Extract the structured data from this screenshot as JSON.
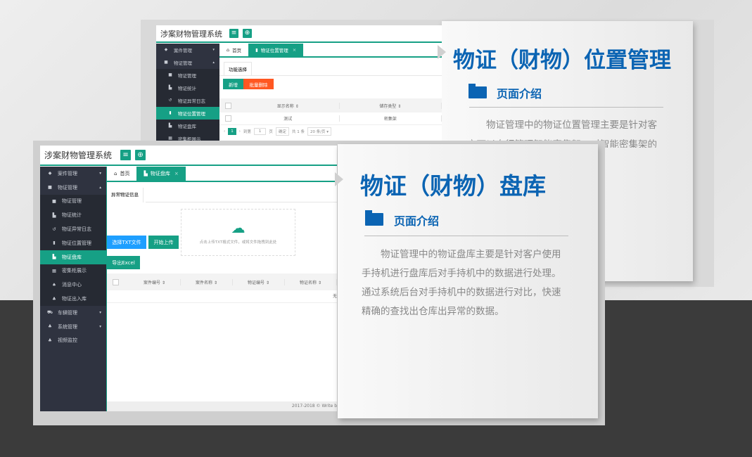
{
  "back_panel": {
    "app_title": "涉案财物管理系统",
    "header_icons": [
      "menu-icon",
      "plus-circle-icon"
    ],
    "sidebar": [
      {
        "label": "案件管理",
        "icon": "tag-icon",
        "caret": "▾"
      },
      {
        "label": "物证管理",
        "icon": "box-icon",
        "caret": "▴"
      },
      {
        "label": "物证管理",
        "icon": "box-icon",
        "sub": true
      },
      {
        "label": "物证统计",
        "icon": "chart-icon",
        "sub": true
      },
      {
        "label": "物证异常日志",
        "icon": "history-icon",
        "sub": true
      },
      {
        "label": "物证位置管理",
        "icon": "bookmark-icon",
        "sub": true,
        "active": true
      },
      {
        "label": "物证盘库",
        "icon": "chart-icon",
        "sub": true
      },
      {
        "label": "密集柜展示",
        "icon": "grid-icon",
        "sub": true
      }
    ],
    "tabs": [
      {
        "label": "首页",
        "icon": "home-icon"
      },
      {
        "label": "物证位置管理",
        "icon": "bookmark-icon",
        "active": true,
        "close": "×"
      }
    ],
    "section_tab": "功能选择",
    "add_button": "新增",
    "batch_delete_button": "批量删除",
    "table": {
      "columns": [
        "显示名称 ⇕",
        "储存类型 ⇕"
      ],
      "rows": [
        [
          "测试",
          "密集架"
        ]
      ]
    },
    "pagination": {
      "prev": "‹",
      "page": "1",
      "next": "›",
      "goto_label": "到第",
      "goto_value": "1",
      "page_unit": "页",
      "confirm": "确定",
      "total": "共 1 条",
      "page_size": "20 条/页"
    },
    "title": "物证（财物）位置管理",
    "intro_heading": "页面介绍",
    "intro_text": "物证管理中的物证位置管理主要是针对客户可以自行管理智能密集架，对智能密集架的存储位"
  },
  "front_panel": {
    "app_title": "涉案财物管理系统",
    "sidebar": [
      {
        "label": "案件管理",
        "icon": "tag-icon",
        "caret": "▾"
      },
      {
        "label": "物证管理",
        "icon": "box-icon",
        "caret": "▴"
      },
      {
        "label": "物证管理",
        "icon": "box-icon",
        "sub": true
      },
      {
        "label": "物证统计",
        "icon": "chart-icon",
        "sub": true
      },
      {
        "label": "物证异常日志",
        "icon": "history-icon",
        "sub": true
      },
      {
        "label": "物证位置管理",
        "icon": "bookmark-icon",
        "sub": true
      },
      {
        "label": "物证盘库",
        "icon": "chart-icon",
        "sub": true,
        "active": true
      },
      {
        "label": "密集柜展示",
        "icon": "grid-icon",
        "sub": true
      },
      {
        "label": "消息中心",
        "icon": "bell-icon",
        "sub": true
      },
      {
        "label": "物证出入库",
        "icon": "cubes-icon",
        "sub": true
      },
      {
        "label": "车辆管理",
        "icon": "car-icon",
        "caret": "▾"
      },
      {
        "label": "系统管理",
        "icon": "cubes-icon",
        "caret": "▾"
      },
      {
        "label": "视频监控",
        "icon": "cubes-icon"
      }
    ],
    "tabs": [
      {
        "label": "首页",
        "icon": "home-icon"
      },
      {
        "label": "物证盘库",
        "icon": "chart-icon",
        "active": true,
        "close": "×"
      }
    ],
    "section_tab": "异常物证信息",
    "select_file_button": "选择TXT文件",
    "upload_button": "开始上传",
    "dropzone_text": "点击上传TXT格式文件，或将文件拖拽到此处",
    "export_button": "导出Excel",
    "table": {
      "columns": [
        "案件编号 ⇕",
        "案件名称 ⇕",
        "物证编号 ⇕",
        "物证名称 ⇕"
      ],
      "empty": "无"
    },
    "footer": "2017-2018 © Write b",
    "title": "物证（财物）盘库",
    "intro_heading": "页面介绍",
    "intro_text": "物证管理中的物证盘库主要是针对客户使用手持机进行盘库后对手持机中的数据进行处理。通过系统后台对手持机中的数据进行对比，快速精确的查找出仓库出异常的数据。"
  },
  "colors": {
    "accent": "#16a085",
    "danger": "#ff5722",
    "blue_button": "#1e9fff",
    "title_blue": "#0b64b3",
    "sidebar": "#2f3340"
  }
}
